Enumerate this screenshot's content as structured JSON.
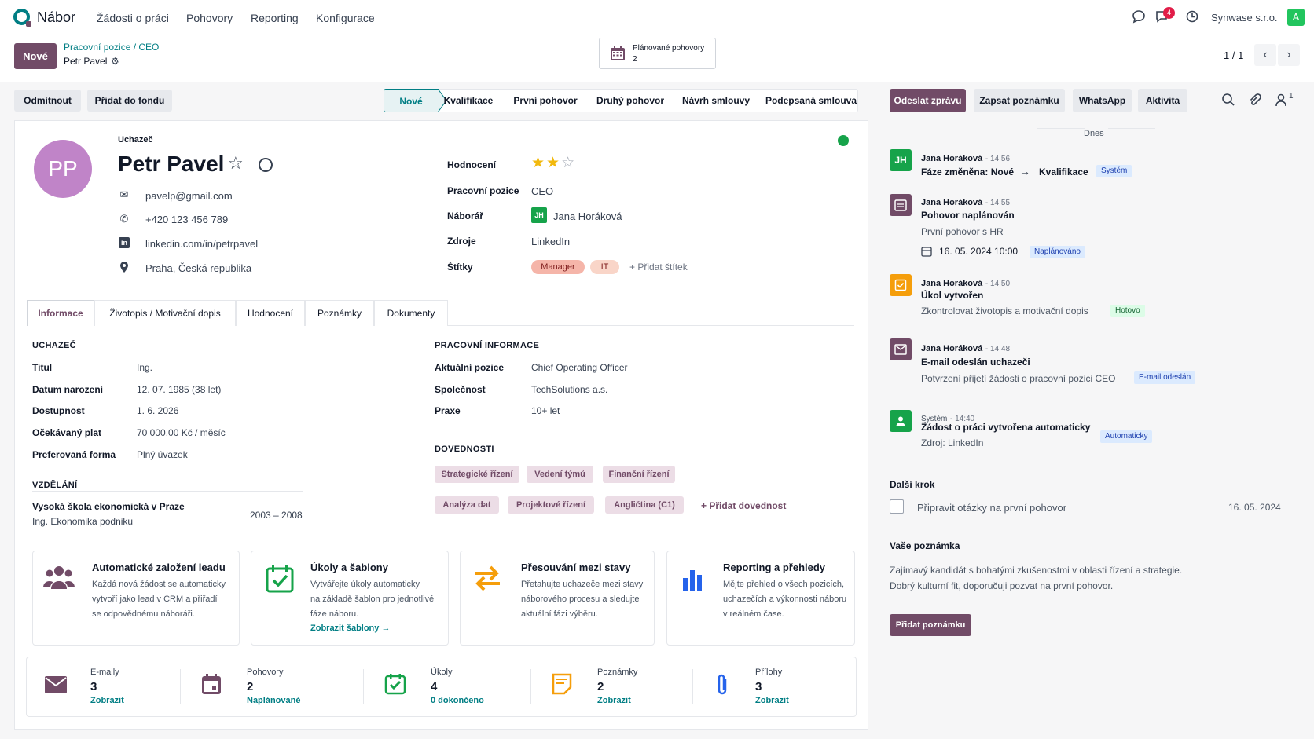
{
  "app": {
    "name": "Nábor",
    "menu": [
      "Žádosti o práci",
      "Pohovory",
      "Reporting",
      "Konfigurace"
    ],
    "notif_count": "4",
    "company": "Synwase s.r.o.",
    "user_initial": "A"
  },
  "control": {
    "new_label": "Nové",
    "breadcrumb": "Pracovní pozice  /  CEO",
    "record_name": "Petr Pavel",
    "smart_button": {
      "label": "Plánované pohovory",
      "value": "2"
    },
    "pager": "1 / 1"
  },
  "actions": {
    "reject": "Odmítnout",
    "add_pool": "Přidat do fondu"
  },
  "stages": [
    "Nové",
    "Kvalifikace",
    "První pohovor",
    "Druhý pohovor",
    "Návrh smlouvy",
    "Podepsaná smlouva"
  ],
  "applicant": {
    "initials": "PP",
    "label": "Uchazeč",
    "name": "Petr Pavel",
    "email": "pavelp@gmail.com",
    "phone": "+420 123 456 789",
    "linkedin": "linkedin.com/in/petrpavel",
    "location": "Praha, Česká republika"
  },
  "summary": {
    "rating_label": "Hodnocení",
    "rating": 2,
    "rating_max": 3,
    "position_label": "Pracovní pozice",
    "position": "CEO",
    "recruiter_label": "Náborář",
    "recruiter_initials": "JH",
    "recruiter": "Jana Horáková",
    "source_label": "Zdroje",
    "source": "LinkedIn",
    "tags_label": "Štítky",
    "tags": [
      "Manager",
      "IT"
    ],
    "add_tag": "+ Přidat štítek"
  },
  "tabs": [
    "Informace",
    "Životopis / Motivační dopis",
    "Hodnocení",
    "Poznámky",
    "Dokumenty"
  ],
  "info": {
    "applicant_section": "UCHAZEČ",
    "fields": [
      {
        "label": "Titul",
        "value": "Ing."
      },
      {
        "label": "Datum narození",
        "value": "12. 07. 1985 (38 let)"
      },
      {
        "label": "Dostupnost",
        "value": "1. 6. 2026"
      },
      {
        "label": "Očekávaný plat",
        "value": "70 000,00 Kč / měsíc"
      },
      {
        "label": "Preferovaná forma",
        "value": "Plný úvazek"
      }
    ],
    "education_section": "VZDĚLÁNÍ",
    "school": "Vysoká škola ekonomická v Praze",
    "degree": "Ing. Ekonomika podniku",
    "years": "2003 – 2008",
    "work_section": "PRACOVNÍ INFORMACE",
    "work_fields": [
      {
        "label": "Aktuální pozice",
        "value": "Chief Operating Officer"
      },
      {
        "label": "Společnost",
        "value": "TechSolutions a.s."
      },
      {
        "label": "Praxe",
        "value": "10+ let"
      }
    ],
    "skills_section": "DOVEDNOSTI",
    "skills_row1": [
      "Strategické řízení",
      "Vedení týmů",
      "Finanční řízení"
    ],
    "skills_row2": [
      "Analýza dat",
      "Projektové řízení",
      "Angličtina (C1)"
    ],
    "add_skill": "+ Přidat dovednost"
  },
  "features": [
    {
      "title": "Automatické založení leadu",
      "desc": [
        "Každá nová žádost se automaticky",
        "vytvoří jako lead v CRM a přiřadí",
        "se odpovědnému náboráři."
      ],
      "icon": "users-icon",
      "link": ""
    },
    {
      "title": "Úkoly a šablony",
      "desc": [
        "Vytvářejte úkoly automaticky",
        "na základě šablon pro jednotlivé",
        "fáze náboru."
      ],
      "icon": "calendar-check-icon",
      "link": "Zobrazit šablony  →"
    },
    {
      "title": "Přesouvání mezi stavy",
      "desc": [
        "Přetahujte uchazeče mezi stavy",
        "náborového procesu a sledujte",
        "aktuální fázi výběru."
      ],
      "icon": "arrows-icon",
      "link": ""
    },
    {
      "title": "Reporting a přehledy",
      "desc": [
        "Mějte přehled o všech pozicích,",
        "uchazečích a výkonnosti náboru",
        "v reálném čase."
      ],
      "icon": "bar-chart-icon",
      "link": ""
    }
  ],
  "stats": [
    {
      "label": "E-maily",
      "value": "3",
      "link": "Zobrazit"
    },
    {
      "label": "Pohovory",
      "value": "2",
      "link": "Naplánované"
    },
    {
      "label": "Úkoly",
      "value": "4",
      "link": "0 dokončeno"
    },
    {
      "label": "Poznámky",
      "value": "2",
      "link": "Zobrazit"
    },
    {
      "label": "Přílohy",
      "value": "3",
      "link": "Zobrazit"
    }
  ],
  "chatter": {
    "send_message": "Odeslat zprávu",
    "log_note": "Zapsat poznámku",
    "whatsapp": "WhatsApp",
    "activity": "Aktivita",
    "followers": "1",
    "today": "Dnes",
    "messages": [
      {
        "author": "Jana Horáková",
        "time": "- 14:56",
        "title": "Fáze změněna: Nové",
        "title2": "Kvalifikace",
        "tag": "Systém"
      },
      {
        "author": "Jana Horáková",
        "time": "- 14:55",
        "title": "Pohovor naplánován",
        "body": "První pohovor s HR",
        "date": "16. 05. 2024 10:00",
        "tag": "Naplánováno"
      },
      {
        "author": "Jana Horáková",
        "time": "- 14:50",
        "title": "Úkol vytvořen",
        "body": "Zkontrolovat životopis a motivační dopis",
        "tag": "Hotovo"
      },
      {
        "author": "Jana Horáková",
        "time": "- 14:48",
        "title": "E-mail odeslán uchazeči",
        "body": "Potvrzení přijetí žádosti o pracovní pozici CEO",
        "tag": "E-mail odeslán"
      },
      {
        "author": "Systém",
        "time": "- 14:40",
        "title": "Žádost o práci vytvořena automaticky",
        "body": "Zdroj: LinkedIn",
        "tag": "Automaticky"
      }
    ],
    "next_step_label": "Další krok",
    "next_step_text": "Připravit otázky na první pohovor",
    "next_step_date": "16. 05. 2024",
    "note_label": "Vaše poznámka",
    "note_lines": [
      "Zajímavý kandidát s bohatými zkušenostmi v oblasti řízení a strategie.",
      "Dobrý kulturní fit, doporučuji pozvat na první pohovor."
    ],
    "add_note": "Přidat poznámku"
  },
  "colors": {
    "primary": "#714b67",
    "teal": "#017e84",
    "green": "#16a34a",
    "orange": "#f59e0b"
  }
}
